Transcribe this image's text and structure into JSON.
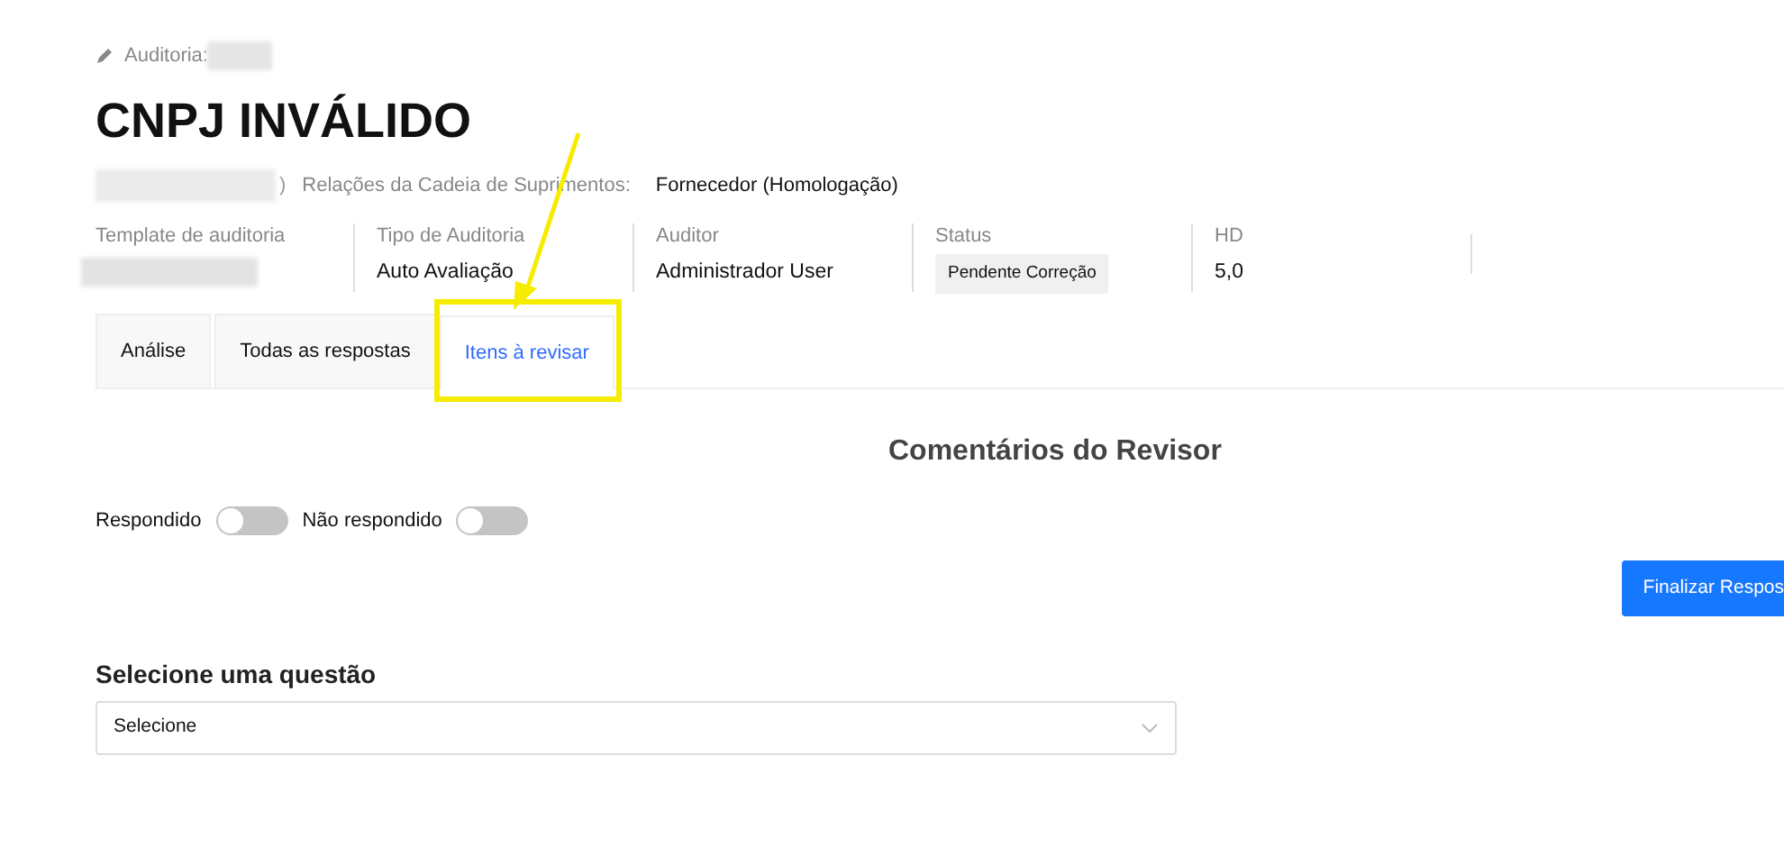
{
  "breadcrumb": {
    "label": "Auditoria:"
  },
  "title": "CNPJ INVÁLIDO",
  "meta": {
    "fragment": ")",
    "label": "Relações da Cadeia de Suprimentos:",
    "value": "Fornecedor (Homologação)"
  },
  "fields": [
    {
      "label": "Template de auditoria",
      "kind": "redacted"
    },
    {
      "label": "Tipo de Auditoria",
      "kind": "text",
      "value": "Auto Avaliação"
    },
    {
      "label": "Auditor",
      "kind": "text",
      "value": "Administrador User"
    },
    {
      "label": "Status",
      "kind": "badge",
      "value": "Pendente Correção"
    },
    {
      "label": "HD",
      "kind": "text",
      "value": "5,0"
    }
  ],
  "tabs": [
    {
      "label": "Análise",
      "selected": false
    },
    {
      "label": "Todas as respostas",
      "selected": false
    },
    {
      "label": "Itens à revisar",
      "selected": true
    }
  ],
  "section_title": "Comentários do Revisor",
  "filters": [
    {
      "label": "Respondido",
      "on": false
    },
    {
      "label": "Não respondido",
      "on": false
    }
  ],
  "finish_button": "Finalizar Respos",
  "question": {
    "label": "Selecione uma questão",
    "value": "Selecione"
  },
  "annotation": {
    "arrow": true,
    "highlight_selected_tab": true
  }
}
